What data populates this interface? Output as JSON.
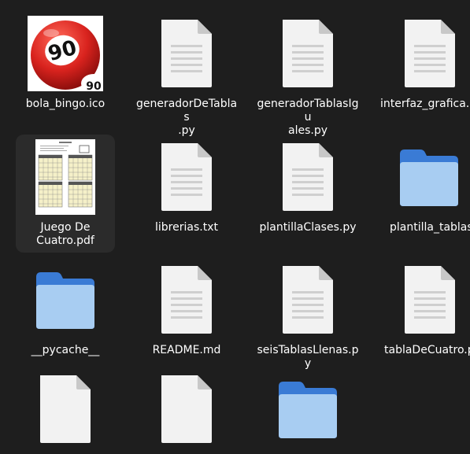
{
  "files": [
    {
      "name": "bola_bingo.ico",
      "type": "image",
      "icon": "bingo-ball-icon",
      "ball_number": "90"
    },
    {
      "name": "generadorDeTablas\n.py",
      "type": "text",
      "icon": "text-file-icon"
    },
    {
      "name": "generadorTablasIgu\nales.py",
      "type": "text",
      "icon": "text-file-icon"
    },
    {
      "name": "interfaz_grafica.p",
      "type": "text",
      "icon": "text-file-icon"
    },
    {
      "name": "Juego De\nCuatro.pdf",
      "type": "pdf",
      "icon": "pdf-thumbnail-icon",
      "selected": true
    },
    {
      "name": "librerias.txt",
      "type": "text",
      "icon": "text-file-icon"
    },
    {
      "name": "plantillaClases.py",
      "type": "text",
      "icon": "text-file-icon"
    },
    {
      "name": "plantilla_tablas",
      "type": "folder",
      "icon": "folder-icon"
    },
    {
      "name": "__pycache__",
      "type": "folder",
      "icon": "folder-icon"
    },
    {
      "name": "README.md",
      "type": "text",
      "icon": "text-file-icon"
    },
    {
      "name": "seisTablasLlenas.py",
      "type": "text",
      "icon": "text-file-icon"
    },
    {
      "name": "tablaDeCuatro.py",
      "type": "text",
      "icon": "text-file-icon"
    },
    {
      "name": "",
      "type": "text",
      "icon": "text-file-icon"
    },
    {
      "name": "",
      "type": "text",
      "icon": "text-file-icon"
    },
    {
      "name": "",
      "type": "folder",
      "icon": "folder-icon"
    }
  ],
  "colors": {
    "background": "#1e1e1e",
    "folder_blue": "#5294e2",
    "selection": "#2b2b2b",
    "bingo_red": "#d62020"
  }
}
